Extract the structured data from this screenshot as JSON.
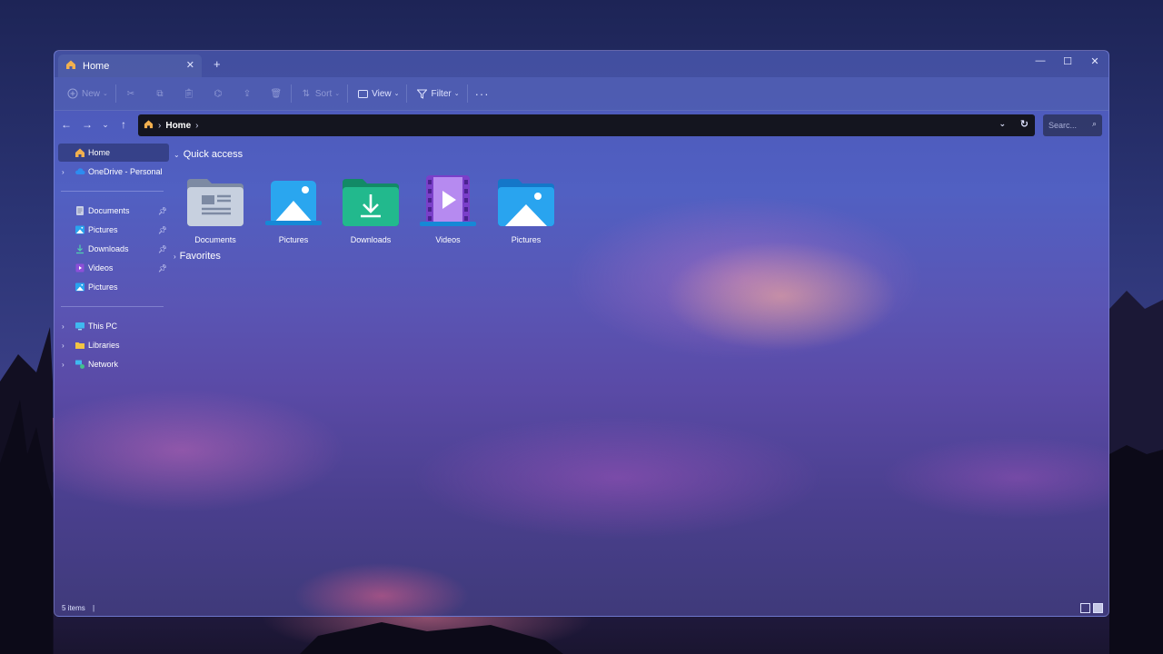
{
  "window": {
    "tab_title": "Home",
    "tab_close_icon": "close-icon",
    "new_tab_label": "+",
    "controls": {
      "minimize": "—",
      "maximize": "☐",
      "close": "✕"
    }
  },
  "toolbar": {
    "new_label": "New",
    "sort_label": "Sort",
    "view_label": "View",
    "filter_label": "Filter",
    "more_label": "···"
  },
  "address": {
    "crumb": "Home",
    "search_placeholder": "Searc..."
  },
  "sidebar": {
    "items": [
      {
        "label": "Home",
        "icon": "home-icon"
      },
      {
        "label": "OneDrive - Personal",
        "icon": "cloud-icon"
      },
      {
        "label": "Documents",
        "icon": "document-icon"
      },
      {
        "label": "Pictures",
        "icon": "picture-icon"
      },
      {
        "label": "Downloads",
        "icon": "download-icon"
      },
      {
        "label": "Videos",
        "icon": "video-icon"
      },
      {
        "label": "Pictures",
        "icon": "picture-icon"
      },
      {
        "label": "This PC",
        "icon": "monitor-icon"
      },
      {
        "label": "Libraries",
        "icon": "folder-icon"
      },
      {
        "label": "Network",
        "icon": "network-icon"
      }
    ]
  },
  "main": {
    "quick_access_label": "Quick access",
    "favorites_label": "Favorites",
    "tiles": [
      {
        "label": "Documents",
        "icon": "documents-folder-icon"
      },
      {
        "label": "Pictures",
        "icon": "pictures-folder-icon"
      },
      {
        "label": "Downloads",
        "icon": "downloads-folder-icon"
      },
      {
        "label": "Videos",
        "icon": "videos-folder-icon"
      },
      {
        "label": "Pictures",
        "icon": "pictures-folder-icon"
      }
    ]
  },
  "status": {
    "items_text": "5 items",
    "separator": "|"
  },
  "colors": {
    "accent": "#4fb6ff",
    "address_bg": "#14151f",
    "downloads_green": "#1fae86",
    "videos_purple": "#8d4fd8"
  }
}
